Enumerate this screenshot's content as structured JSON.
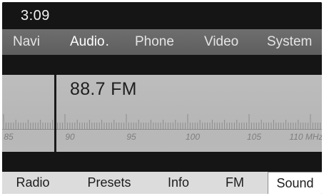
{
  "status": {
    "time": "3:09"
  },
  "main_menu": {
    "items": [
      {
        "label": "Navi",
        "active": false
      },
      {
        "label": "Audio",
        "active": true
      },
      {
        "label": "Phone",
        "active": false
      },
      {
        "label": "Video",
        "active": false
      },
      {
        "label": "System",
        "active": false
      }
    ],
    "active_marker": "."
  },
  "tuner": {
    "frequency": "88.7 FM",
    "scale_labels": [
      "85",
      "90",
      "95",
      "100",
      "105",
      "110 MHz"
    ]
  },
  "softkeys": {
    "items": [
      {
        "label": "Radio",
        "selected": false
      },
      {
        "label": "Presets",
        "selected": false
      },
      {
        "label": "Info",
        "selected": false
      },
      {
        "label": "FM",
        "selected": false
      },
      {
        "label": "Sound",
        "selected": true
      }
    ]
  },
  "colors": {
    "frame": "#151515",
    "menu_bar": "#666666",
    "tuner_bg": "#bbbbbb",
    "softkey_bar": "#dcdcdc",
    "selected_key": "#ffffff"
  }
}
